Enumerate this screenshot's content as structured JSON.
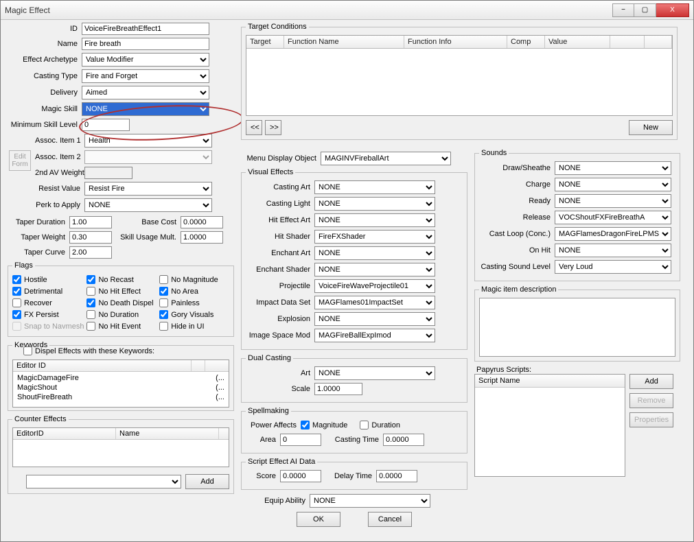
{
  "window": {
    "title": "Magic Effect"
  },
  "winbuttons": {
    "min": "−",
    "max": "▢",
    "close": "X"
  },
  "basic": {
    "labels": {
      "id": "ID",
      "name": "Name",
      "archetype": "Effect Archetype",
      "casting_type": "Casting Type",
      "delivery": "Delivery",
      "magic_skill": "Magic Skill",
      "min_skill": "Minimum Skill Level",
      "assoc1": "Assoc. Item 1",
      "assoc2": "Assoc. Item 2",
      "second_av": "2nd AV Weight",
      "resist": "Resist Value",
      "perk": "Perk to Apply",
      "taper_dur": "Taper Duration",
      "taper_wgt": "Taper Weight",
      "taper_curve": "Taper Curve",
      "base_cost": "Base Cost",
      "skill_mult": "Skill Usage Mult."
    },
    "values": {
      "id": "VoiceFireBreathEffect1",
      "name": "Fire breath",
      "archetype": "Value Modifier",
      "casting_type": "Fire and Forget",
      "delivery": "Aimed",
      "magic_skill": "NONE",
      "min_skill": "0",
      "assoc1": "Health",
      "assoc2": "",
      "second_av": "",
      "resist": "Resist Fire",
      "perk": "NONE",
      "taper_dur": "1.00",
      "taper_wgt": "0.30",
      "taper_curve": "2.00",
      "base_cost": "0.0000",
      "skill_mult": "1.0000"
    }
  },
  "editform": {
    "line1": "Edit",
    "line2": "Form"
  },
  "flags": {
    "legend": "Flags",
    "items": [
      {
        "label": "Hostile",
        "checked": true,
        "enabled": true
      },
      {
        "label": "No Recast",
        "checked": true,
        "enabled": true
      },
      {
        "label": "No Magnitude",
        "checked": false,
        "enabled": true
      },
      {
        "label": "Detrimental",
        "checked": true,
        "enabled": true
      },
      {
        "label": "No Hit Effect",
        "checked": false,
        "enabled": true
      },
      {
        "label": "No Area",
        "checked": true,
        "enabled": true
      },
      {
        "label": "Recover",
        "checked": false,
        "enabled": true
      },
      {
        "label": "No Death Dispel",
        "checked": true,
        "enabled": true
      },
      {
        "label": "Painless",
        "checked": false,
        "enabled": true
      },
      {
        "label": "FX Persist",
        "checked": true,
        "enabled": true
      },
      {
        "label": "No Duration",
        "checked": false,
        "enabled": true
      },
      {
        "label": "Gory Visuals",
        "checked": true,
        "enabled": true
      },
      {
        "label": "Snap to Navmesh",
        "checked": false,
        "enabled": false
      },
      {
        "label": "No Hit Event",
        "checked": false,
        "enabled": true
      },
      {
        "label": "Hide in UI",
        "checked": false,
        "enabled": true
      }
    ]
  },
  "keywords": {
    "legend": "Keywords",
    "dispel_label": "Dispel Effects with these Keywords:",
    "dispel_checked": false,
    "header": "Editor ID",
    "items": [
      "MagicDamageFire",
      "MagicShout",
      "ShoutFireBreath"
    ],
    "ellipsis": "(..."
  },
  "counter": {
    "legend": "Counter Effects",
    "headers": [
      "EditorID",
      "Name"
    ],
    "add": "Add"
  },
  "tc": {
    "legend": "Target Conditions",
    "headers": [
      "Target",
      "Function Name",
      "Function Info",
      "Comp",
      "Value"
    ],
    "nav_prev": "<<",
    "nav_next": ">>",
    "new": "New"
  },
  "menu_display": {
    "label": "Menu Display Object",
    "value": "MAGINVFireballArt"
  },
  "vfx": {
    "legend": "Visual Effects",
    "labels": {
      "casting_art": "Casting Art",
      "casting_light": "Casting Light",
      "hit_effect": "Hit Effect Art",
      "hit_shader": "Hit Shader",
      "enchant_art": "Enchant Art",
      "enchant_shader": "Enchant Shader",
      "projectile": "Projectile",
      "impact": "Impact Data Set",
      "explosion": "Explosion",
      "imagespace": "Image Space Mod"
    },
    "values": {
      "casting_art": "NONE",
      "casting_light": "NONE",
      "hit_effect": "NONE",
      "hit_shader": "FireFXShader",
      "enchant_art": "NONE",
      "enchant_shader": "NONE",
      "projectile": "VoiceFireWaveProjectile01",
      "impact": "MAGFlames01ImpactSet",
      "explosion": "NONE",
      "imagespace": "MAGFireBallExpImod"
    }
  },
  "dual": {
    "legend": "Dual Casting",
    "art_label": "Art",
    "art_value": "NONE",
    "scale_label": "Scale",
    "scale_value": "1.0000"
  },
  "spellmaking": {
    "legend": "Spellmaking",
    "power_label": "Power Affects",
    "magnitude": "Magnitude",
    "magnitude_checked": true,
    "duration": "Duration",
    "duration_checked": false,
    "area_label": "Area",
    "area_value": "0",
    "ctime_label": "Casting Time",
    "ctime_value": "0.0000"
  },
  "scriptai": {
    "legend": "Script Effect AI Data",
    "score_label": "Score",
    "score_value": "0.0000",
    "delay_label": "Delay Time",
    "delay_value": "0.0000"
  },
  "equip": {
    "label": "Equip Ability",
    "value": "NONE"
  },
  "okcancel": {
    "ok": "OK",
    "cancel": "Cancel"
  },
  "sounds": {
    "legend": "Sounds",
    "labels": {
      "draw": "Draw/Sheathe",
      "charge": "Charge",
      "ready": "Ready",
      "release": "Release",
      "loop": "Cast Loop (Conc.)",
      "onhit": "On Hit",
      "level": "Casting Sound Level"
    },
    "values": {
      "draw": "NONE",
      "charge": "NONE",
      "ready": "NONE",
      "release": "VOCShoutFXFireBreathA",
      "loop": "MAGFlamesDragonFireLPMSD",
      "onhit": "NONE",
      "level": "Very Loud"
    }
  },
  "desc": {
    "legend": "Magic item description"
  },
  "scripts": {
    "legend": "Papyrus Scripts:",
    "header": "Script Name",
    "add": "Add",
    "remove": "Remove",
    "properties": "Properties"
  }
}
